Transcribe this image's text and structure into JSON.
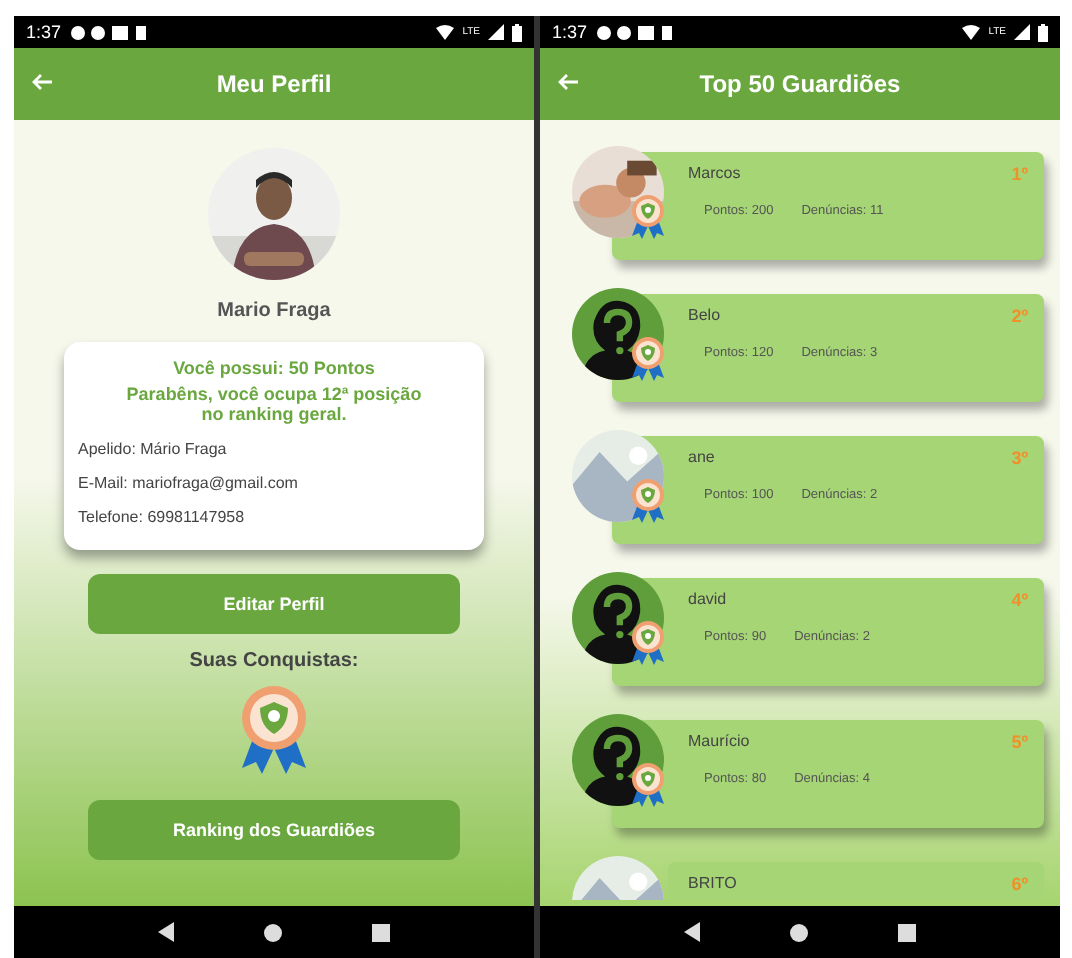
{
  "left_screen": {
    "status_bar": {
      "time": "1:37",
      "network": "LTE"
    },
    "app_bar": {
      "title": "Meu Perfil"
    },
    "profile": {
      "name": "Mario Fraga",
      "points": "Você possui: 50 Pontos",
      "ranking_message": "Parabêns, você ocupa 12ª posição no ranking geral.",
      "details": [
        "Apelido: Mário Fraga",
        "E-Mail: mariofraga@gmail.com",
        "Telefone: 69981147958"
      ]
    },
    "edit_button": "Editar Perfil",
    "achievements_label": "Suas Conquistas:",
    "ranking_button": "Ranking dos Guardiões"
  },
  "right_screen": {
    "status_bar": {
      "time": "1:37",
      "network": "LTE"
    },
    "app_bar": {
      "title": "Top 50 Guardiões"
    },
    "rows": [
      {
        "name": "Marcos",
        "rank": "1º",
        "points": "Pontos: 200",
        "reports": "Denúncias: 11"
      },
      {
        "name": "Belo",
        "rank": "2º",
        "points": "Pontos: 120",
        "reports": "Denúncias: 3",
        "kind": "placeholder"
      },
      {
        "name": "ane",
        "rank": "3º",
        "points": "Pontos: 100",
        "reports": "Denúncias: 2"
      },
      {
        "name": "david",
        "rank": "4º",
        "points": "Pontos: 90",
        "reports": "Denúncias: 2",
        "kind": "placeholder"
      },
      {
        "name": "Maurício",
        "rank": "5º",
        "points": "Pontos: 80",
        "reports": "Denúncias: 4",
        "kind": "placeholder"
      },
      {
        "name": "BRITO",
        "rank": "6º"
      }
    ]
  }
}
